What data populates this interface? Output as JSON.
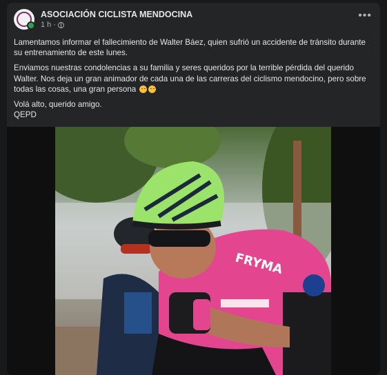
{
  "post": {
    "page_name": "ASOCIACIÓN CICLISTA MENDOCINA",
    "time": "1 h ·",
    "more": "•••",
    "paragraphs": [
      "Lamentamos informar el fallecimiento de Walter Báez, quien sufrió un accidente de tránsito durante su entrenamiento de este lunes.",
      "Enviamos nuestras condolencias a su familia y seres queridos por la terrible pérdida del querido Walter. Nos deja un gran animador de cada una de las carreras del ciclismo mendocino, pero sobre todas las cosas, una gran persona"
    ],
    "closing_line1": "Volá alto, querido amigo.",
    "closing_line2": "QEPD"
  },
  "colors": {
    "background": "#18191a",
    "card": "#242526",
    "text_primary": "#e4e6eb",
    "text_secondary": "#b0b3b8",
    "jersey": "#e4458f",
    "helmet": "#9be36a"
  },
  "icons": {
    "avatar": "club-logo-icon",
    "privacy": "globe-icon",
    "more": "more-options-icon",
    "emoji1": "pleading-face-icon",
    "emoji2": "pensive-face-icon"
  }
}
